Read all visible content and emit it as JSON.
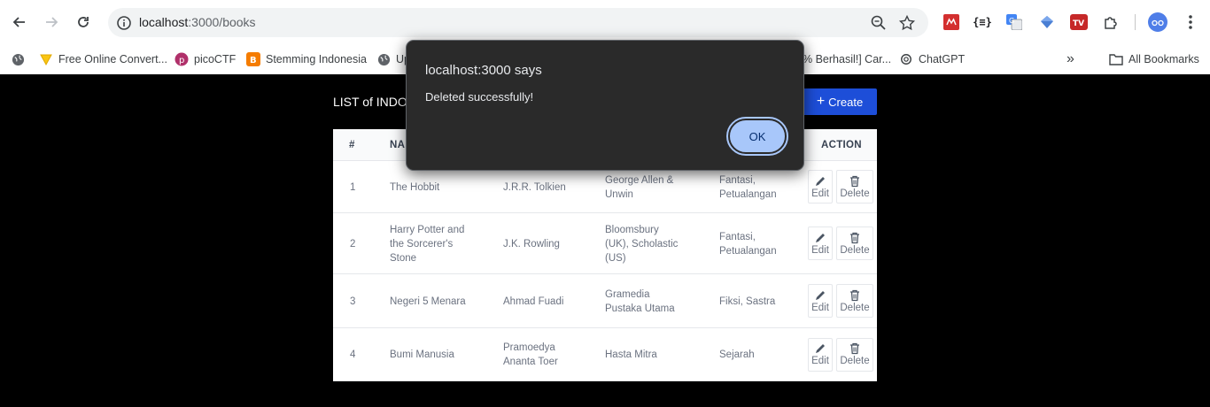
{
  "browser": {
    "url_host": "localhost",
    "url_path": ":3000/books",
    "bookmarks": [
      "Free Online Convert...",
      "picoCTF",
      "Stemming Indonesia",
      "Up",
      "% Berhasil!] Car...",
      "ChatGPT"
    ],
    "all_bookmarks": "All Bookmarks",
    "more": "»"
  },
  "page": {
    "title": "LIST of INDON",
    "create_label": "Create",
    "create_plus": "+"
  },
  "table": {
    "headers": [
      "#",
      "NA",
      "ACTION"
    ],
    "rows": [
      {
        "num": "1",
        "name": [
          "The Hobbit"
        ],
        "author": [
          "J.R.R. Tolkien"
        ],
        "publisher": [
          "George Allen &",
          "Unwin"
        ],
        "genre": [
          "Fantasi,",
          "Petualangan"
        ]
      },
      {
        "num": "2",
        "name": [
          "Harry Potter and",
          "the Sorcerer's",
          "Stone"
        ],
        "author": [
          "J.K. Rowling"
        ],
        "publisher": [
          "Bloomsbury",
          "(UK), Scholastic",
          "(US)"
        ],
        "genre": [
          "Fantasi,",
          "Petualangan"
        ]
      },
      {
        "num": "3",
        "name": [
          "Negeri 5 Menara"
        ],
        "author": [
          "Ahmad Fuadi"
        ],
        "publisher": [
          "Gramedia",
          "Pustaka Utama"
        ],
        "genre": [
          "Fiksi, Sastra"
        ]
      },
      {
        "num": "4",
        "name": [
          "Bumi Manusia"
        ],
        "author": [
          "Pramoedya",
          "Ananta Toer"
        ],
        "publisher": [
          "Hasta Mitra"
        ],
        "genre": [
          "Sejarah"
        ]
      }
    ],
    "edit_label": "Edit",
    "delete_label": "Delete"
  },
  "dialog": {
    "title": "localhost:3000 says",
    "message": "Deleted successfully!",
    "ok_label": "OK"
  },
  "colors": {
    "accent": "#1d4ed8",
    "dialog_bg": "#2a2a2a",
    "ok_bg": "#a8c7fa"
  }
}
